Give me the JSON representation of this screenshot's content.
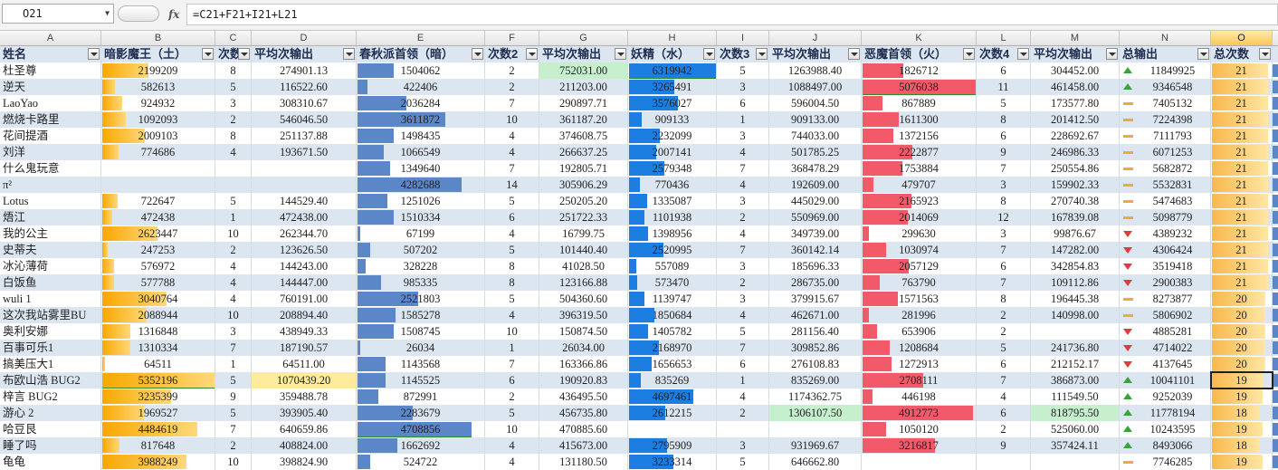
{
  "formula_bar": {
    "name_box": "O21",
    "formula": "=C21+F21+I21+L21"
  },
  "columns": [
    "A",
    "B",
    "C",
    "D",
    "E",
    "F",
    "G",
    "H",
    "I",
    "J",
    "K",
    "L",
    "M",
    "N",
    "O"
  ],
  "selected_column": "O",
  "headers": [
    "姓名",
    "暗影魔王（土）",
    "次数",
    "平均次输出",
    "春秋派首领（暗）",
    "次数2",
    "平均次输出",
    "妖精（水）",
    "次数3",
    "平均次输出",
    "恶魔首领（火）",
    "次数4",
    "平均次输出",
    "总输出",
    "总次数"
  ],
  "rows": [
    {
      "name": "杜圣尊",
      "b": "2199209",
      "c": "8",
      "d": "274901.13",
      "e": "1504062",
      "f": "2",
      "g": "752031.00",
      "h": "6319942",
      "i": "5",
      "j": "1263988.40",
      "k": "1826712",
      "l": "6",
      "m": "304452.00",
      "n": "11849925",
      "o": "21",
      "trend": "up"
    },
    {
      "name": "逆天",
      "b": "582613",
      "c": "5",
      "d": "116522.60",
      "e": "422406",
      "f": "2",
      "g": "211203.00",
      "h": "3265491",
      "i": "3",
      "j": "1088497.00",
      "k": "5076038",
      "l": "11",
      "m": "461458.00",
      "n": "9346548",
      "o": "21",
      "trend": "up"
    },
    {
      "name": "LaoYao",
      "b": "924932",
      "c": "3",
      "d": "308310.67",
      "e": "2036284",
      "f": "7",
      "g": "290897.71",
      "h": "3576027",
      "i": "6",
      "j": "596004.50",
      "k": "867889",
      "l": "5",
      "m": "173577.80",
      "n": "7405132",
      "o": "21",
      "trend": "mid"
    },
    {
      "name": "燃烧卡路里",
      "b": "1092093",
      "c": "2",
      "d": "546046.50",
      "e": "3611872",
      "f": "10",
      "g": "361187.20",
      "h": "909133",
      "i": "1",
      "j": "909133.00",
      "k": "1611300",
      "l": "8",
      "m": "201412.50",
      "n": "7224398",
      "o": "21",
      "trend": "mid"
    },
    {
      "name": "花间提酒",
      "b": "2009103",
      "c": "8",
      "d": "251137.88",
      "e": "1498435",
      "f": "4",
      "g": "374608.75",
      "h": "2232099",
      "i": "3",
      "j": "744033.00",
      "k": "1372156",
      "l": "6",
      "m": "228692.67",
      "n": "7111793",
      "o": "21",
      "trend": "mid"
    },
    {
      "name": "刘洋",
      "b": "774686",
      "c": "4",
      "d": "193671.50",
      "e": "1066549",
      "f": "4",
      "g": "266637.25",
      "h": "2007141",
      "i": "4",
      "j": "501785.25",
      "k": "2222877",
      "l": "9",
      "m": "246986.33",
      "n": "6071253",
      "o": "21",
      "trend": "mid"
    },
    {
      "name": "什么鬼玩意",
      "b": "",
      "c": "",
      "d": "",
      "e": "1349640",
      "f": "7",
      "g": "192805.71",
      "h": "2579348",
      "i": "7",
      "j": "368478.29",
      "k": "1753884",
      "l": "7",
      "m": "250554.86",
      "n": "5682872",
      "o": "21",
      "trend": "mid"
    },
    {
      "name": "π²",
      "b": "",
      "c": "",
      "d": "",
      "e": "4282688",
      "f": "14",
      "g": "305906.29",
      "h": "770436",
      "i": "4",
      "j": "192609.00",
      "k": "479707",
      "l": "3",
      "m": "159902.33",
      "n": "5532831",
      "o": "21",
      "trend": "mid"
    },
    {
      "name": "Lotus",
      "b": "722647",
      "c": "5",
      "d": "144529.40",
      "e": "1251026",
      "f": "5",
      "g": "250205.20",
      "h": "1335087",
      "i": "3",
      "j": "445029.00",
      "k": "2165923",
      "l": "8",
      "m": "270740.38",
      "n": "5474683",
      "o": "21",
      "trend": "mid"
    },
    {
      "name": "焐江",
      "b": "472438",
      "c": "1",
      "d": "472438.00",
      "e": "1510334",
      "f": "6",
      "g": "251722.33",
      "h": "1101938",
      "i": "2",
      "j": "550969.00",
      "k": "2014069",
      "l": "12",
      "m": "167839.08",
      "n": "5098779",
      "o": "21",
      "trend": "mid"
    },
    {
      "name": "我的公主",
      "b": "2623447",
      "c": "10",
      "d": "262344.70",
      "e": "67199",
      "f": "4",
      "g": "16799.75",
      "h": "1398956",
      "i": "4",
      "j": "349739.00",
      "k": "299630",
      "l": "3",
      "m": "99876.67",
      "n": "4389232",
      "o": "21",
      "trend": "dn"
    },
    {
      "name": "史蒂夫",
      "b": "247253",
      "c": "2",
      "d": "123626.50",
      "e": "507202",
      "f": "5",
      "g": "101440.40",
      "h": "2520995",
      "i": "7",
      "j": "360142.14",
      "k": "1030974",
      "l": "7",
      "m": "147282.00",
      "n": "4306424",
      "o": "21",
      "trend": "dn"
    },
    {
      "name": "冰沁薄荷",
      "b": "576972",
      "c": "4",
      "d": "144243.00",
      "e": "328228",
      "f": "8",
      "g": "41028.50",
      "h": "557089",
      "i": "3",
      "j": "185696.33",
      "k": "2057129",
      "l": "6",
      "m": "342854.83",
      "n": "3519418",
      "o": "21",
      "trend": "dn"
    },
    {
      "name": "白饭鱼",
      "b": "577788",
      "c": "4",
      "d": "144447.00",
      "e": "985335",
      "f": "8",
      "g": "123166.88",
      "h": "573470",
      "i": "2",
      "j": "286735.00",
      "k": "763790",
      "l": "7",
      "m": "109112.86",
      "n": "2900383",
      "o": "21",
      "trend": "dn"
    },
    {
      "name": "wuli 1",
      "b": "3040764",
      "c": "4",
      "d": "760191.00",
      "e": "2521803",
      "f": "5",
      "g": "504360.60",
      "h": "1139747",
      "i": "3",
      "j": "379915.67",
      "k": "1571563",
      "l": "8",
      "m": "196445.38",
      "n": "8273877",
      "o": "20",
      "trend": "mid"
    },
    {
      "name": "这次我站雾里BU",
      "b": "2088944",
      "c": "10",
      "d": "208894.40",
      "e": "1585278",
      "f": "4",
      "g": "396319.50",
      "h": "1850684",
      "i": "4",
      "j": "462671.00",
      "k": "281996",
      "l": "2",
      "m": "140998.00",
      "n": "5806902",
      "o": "20",
      "trend": "mid"
    },
    {
      "name": "奥利安娜",
      "b": "1316848",
      "c": "3",
      "d": "438949.33",
      "e": "1508745",
      "f": "10",
      "g": "150874.50",
      "h": "1405782",
      "i": "5",
      "j": "281156.40",
      "k": "653906",
      "l": "2",
      "m": "",
      "n": "4885281",
      "o": "20",
      "trend": "dn"
    },
    {
      "name": "百事可乐1",
      "b": "1310334",
      "c": "7",
      "d": "187190.57",
      "e": "26034",
      "f": "1",
      "g": "26034.00",
      "h": "2168970",
      "i": "7",
      "j": "309852.86",
      "k": "1208684",
      "l": "5",
      "m": "241736.80",
      "n": "4714022",
      "o": "20",
      "trend": "dn"
    },
    {
      "name": "搞美压大1",
      "b": "64511",
      "c": "1",
      "d": "64511.00",
      "e": "1143568",
      "f": "7",
      "g": "163366.86",
      "h": "1656653",
      "i": "6",
      "j": "276108.83",
      "k": "1272913",
      "l": "6",
      "m": "212152.17",
      "n": "4137645",
      "o": "20",
      "trend": "dn"
    },
    {
      "name": "布欧山浩 BUG2",
      "b": "5352196",
      "c": "5",
      "d": "1070439.20",
      "e": "1145525",
      "f": "6",
      "g": "190920.83",
      "h": "835269",
      "i": "1",
      "j": "835269.00",
      "k": "2708111",
      "l": "7",
      "m": "386873.00",
      "n": "10041101",
      "o": "19",
      "trend": "up"
    },
    {
      "name": "梓言  BUG2",
      "b": "3235399",
      "c": "9",
      "d": "359488.78",
      "e": "872991",
      "f": "2",
      "g": "436495.50",
      "h": "4697461",
      "i": "4",
      "j": "1174362.75",
      "k": "446198",
      "l": "4",
      "m": "111549.50",
      "n": "9252039",
      "o": "19",
      "trend": "up"
    },
    {
      "name": "游心 2",
      "b": "1969527",
      "c": "5",
      "d": "393905.40",
      "e": "2283679",
      "f": "5",
      "g": "456735.80",
      "h": "2612215",
      "i": "2",
      "j": "1306107.50",
      "k": "4912773",
      "l": "6",
      "m": "818795.50",
      "n": "11778194",
      "o": "18",
      "trend": "up"
    },
    {
      "name": "哈豆艮",
      "b": "4484619",
      "c": "7",
      "d": "640659.86",
      "e": "4708856",
      "f": "10",
      "g": "470885.60",
      "h": "",
      "i": "",
      "j": "",
      "k": "1050120",
      "l": "2",
      "m": "525060.00",
      "n": "10243595",
      "o": "19",
      "trend": "up"
    },
    {
      "name": "睡了吗",
      "b": "817648",
      "c": "2",
      "d": "408824.00",
      "e": "1662692",
      "f": "4",
      "g": "415673.00",
      "h": "2795909",
      "i": "3",
      "j": "931969.67",
      "k": "3216817",
      "l": "9",
      "m": "357424.11",
      "n": "8493066",
      "o": "18",
      "trend": "up"
    },
    {
      "name": "龟龟",
      "b": "3988249",
      "c": "10",
      "d": "398824.90",
      "e": "524722",
      "f": "4",
      "g": "131180.50",
      "h": "3233314",
      "i": "5",
      "j": "646662.80",
      "k": "",
      "l": "",
      "m": "",
      "n": "7746285",
      "o": "19",
      "trend": "mid"
    }
  ],
  "colors": {
    "gold": "#f8a800",
    "steel": "#5b86c8",
    "azure": "#1b7ee0",
    "red": "#f25a6a",
    "green_hl": "#c6efce",
    "yellow_hl": "#ffeb9c",
    "band": "#dce6f1"
  }
}
